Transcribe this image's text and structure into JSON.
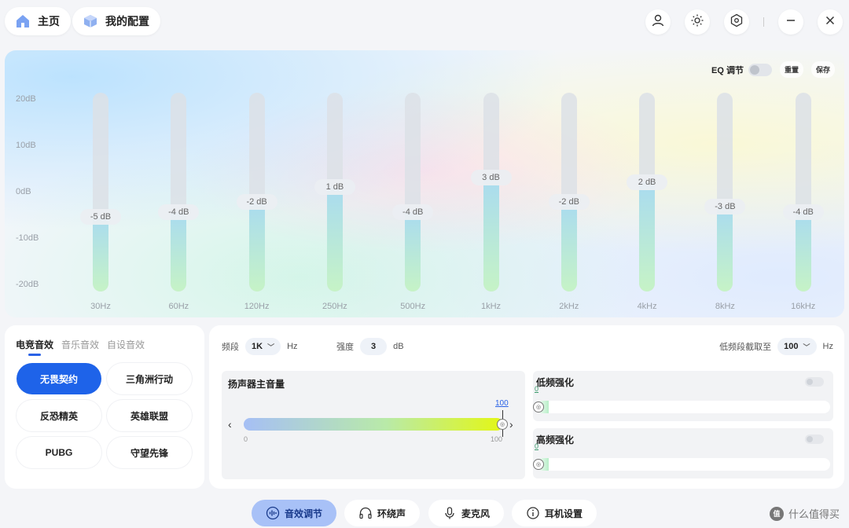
{
  "header": {
    "tabs": [
      {
        "label": "主页",
        "icon": "home-icon"
      },
      {
        "label": "我的配置",
        "icon": "cube-icon"
      }
    ],
    "actions": [
      "user-icon",
      "brightness-icon",
      "settings-hex-icon",
      "minimize-icon",
      "close-icon"
    ]
  },
  "eq": {
    "toggle_label": "EQ 调节",
    "reset_label": "重置",
    "save_label": "保存",
    "y_labels": [
      "20dB",
      "10dB",
      "0dB",
      "-10dB",
      "-20dB"
    ],
    "bands": [
      {
        "freq": "30Hz",
        "label": "-5 dB",
        "value": -5
      },
      {
        "freq": "60Hz",
        "label": "-4 dB",
        "value": -4
      },
      {
        "freq": "120Hz",
        "label": "-2 dB",
        "value": -2
      },
      {
        "freq": "250Hz",
        "label": "1 dB",
        "value": 1
      },
      {
        "freq": "500Hz",
        "label": "-4 dB",
        "value": -4
      },
      {
        "freq": "1kHz",
        "label": "3 dB",
        "value": 3
      },
      {
        "freq": "2kHz",
        "label": "-2 dB",
        "value": -2
      },
      {
        "freq": "4kHz",
        "label": "2 dB",
        "value": 2
      },
      {
        "freq": "8kHz",
        "label": "-3 dB",
        "value": -3
      },
      {
        "freq": "16kHz",
        "label": "-4 dB",
        "value": -4
      }
    ]
  },
  "presets": {
    "tabs": [
      "电竞音效",
      "音乐音效",
      "自设音效"
    ],
    "active_tab": 0,
    "items": [
      "无畏契约",
      "三角洲行动",
      "反恐精英",
      "英雄联盟",
      "PUBG",
      "守望先锋"
    ],
    "active_item": 0
  },
  "controls": {
    "band_label": "频段",
    "band_value": "1K",
    "band_unit": "Hz",
    "gain_label": "强度",
    "gain_value": "3",
    "gain_unit": "dB",
    "cutoff_label": "低频段截取至",
    "cutoff_value": "100",
    "cutoff_unit": "Hz",
    "speaker": {
      "title": "扬声器主音量",
      "value": "100",
      "level": 1.0,
      "min": "0",
      "max": "100"
    },
    "bass": {
      "title": "低频强化",
      "value": "0"
    },
    "treble": {
      "title": "高频强化",
      "value": "0"
    }
  },
  "bottom_nav": [
    {
      "label": "音效调节",
      "icon": "waveform-icon",
      "active": true
    },
    {
      "label": "环绕声",
      "icon": "headphones-icon",
      "active": false
    },
    {
      "label": "麦克风",
      "icon": "microphone-icon",
      "active": false
    },
    {
      "label": "耳机设置",
      "icon": "info-icon",
      "active": false
    }
  ],
  "watermark": {
    "badge": "值",
    "text": "什么值得买"
  }
}
